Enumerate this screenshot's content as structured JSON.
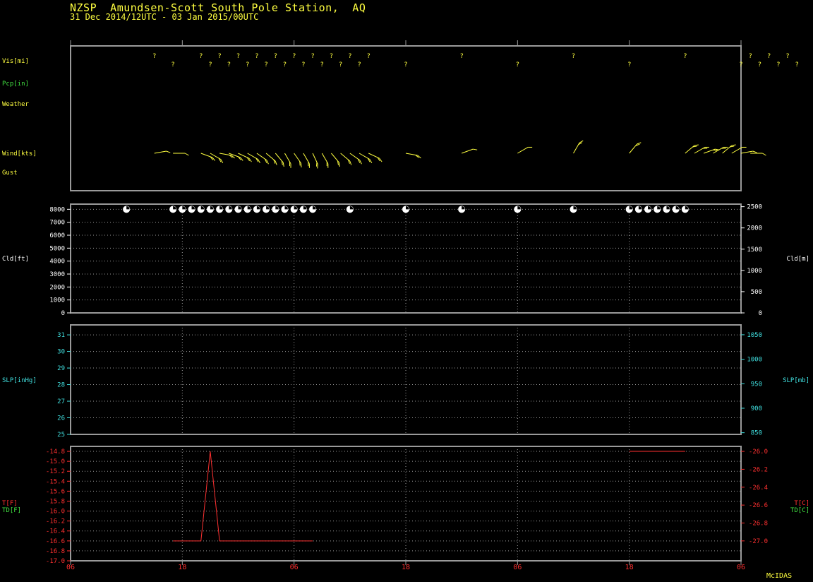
{
  "header": {
    "station_line": "NZSP  Amundsen-Scott South Pole Station,  AQ",
    "period_line": "31 Dec 2014/12UTC - 03 Jan 2015/00UTC"
  },
  "credit": "McIDAS",
  "colors": {
    "yellow": "#ffff40",
    "green": "#40e040",
    "cyan": "#40e0e0",
    "red": "#ff3030",
    "white": "#ffffff",
    "frame": "#9a9a9a",
    "grid": "#9a9a9a"
  },
  "time_axis": {
    "tick_labels": [
      "06",
      "18",
      "06",
      "18",
      "06",
      "18",
      "06"
    ],
    "grid_labels": [
      "18",
      "06",
      "18",
      "06",
      "18"
    ]
  },
  "chart_data": [
    {
      "type": "scatter",
      "panel": "surface",
      "row_labels": {
        "vis": "Vis[mi]",
        "pcp": "Pcp[in]",
        "weather": "Weather",
        "wind": "Wind[kts]",
        "gust": "Gust"
      },
      "vis_symbol": "?",
      "vis_hours": [
        9,
        11,
        14,
        15,
        16,
        17,
        18,
        19,
        20,
        21,
        22,
        23,
        24,
        25,
        26,
        27,
        28,
        29,
        30,
        31,
        32,
        36,
        42,
        48,
        54,
        60,
        66,
        72,
        73,
        74,
        75,
        76,
        77,
        78
      ],
      "wind_barbs": [
        {
          "hour": 9,
          "dir": 80,
          "spd": 10
        },
        {
          "hour": 11,
          "dir": 90,
          "spd": 10
        },
        {
          "hour": 14,
          "dir": 110,
          "spd": 15
        },
        {
          "hour": 15,
          "dir": 120,
          "spd": 15
        },
        {
          "hour": 16,
          "dir": 100,
          "spd": 15
        },
        {
          "hour": 17,
          "dir": 110,
          "spd": 15
        },
        {
          "hour": 18,
          "dir": 115,
          "spd": 15
        },
        {
          "hour": 19,
          "dir": 120,
          "spd": 15
        },
        {
          "hour": 20,
          "dir": 125,
          "spd": 15
        },
        {
          "hour": 21,
          "dir": 130,
          "spd": 15
        },
        {
          "hour": 22,
          "dir": 140,
          "spd": 15
        },
        {
          "hour": 23,
          "dir": 150,
          "spd": 15
        },
        {
          "hour": 24,
          "dir": 145,
          "spd": 15
        },
        {
          "hour": 25,
          "dir": 150,
          "spd": 15
        },
        {
          "hour": 26,
          "dir": 155,
          "spd": 15
        },
        {
          "hour": 27,
          "dir": 150,
          "spd": 15
        },
        {
          "hour": 28,
          "dir": 140,
          "spd": 15
        },
        {
          "hour": 29,
          "dir": 130,
          "spd": 15
        },
        {
          "hour": 30,
          "dir": 125,
          "spd": 15
        },
        {
          "hour": 31,
          "dir": 120,
          "spd": 15
        },
        {
          "hour": 32,
          "dir": 115,
          "spd": 15
        },
        {
          "hour": 36,
          "dir": 100,
          "spd": 15
        },
        {
          "hour": 42,
          "dir": 70,
          "spd": 10
        },
        {
          "hour": 48,
          "dir": 60,
          "spd": 10
        },
        {
          "hour": 54,
          "dir": 30,
          "spd": 15
        },
        {
          "hour": 60,
          "dir": 40,
          "spd": 15
        },
        {
          "hour": 66,
          "dir": 50,
          "spd": 15
        },
        {
          "hour": 67,
          "dir": 60,
          "spd": 15
        },
        {
          "hour": 68,
          "dir": 70,
          "spd": 15
        },
        {
          "hour": 69,
          "dir": 60,
          "spd": 15
        },
        {
          "hour": 70,
          "dir": 50,
          "spd": 15
        },
        {
          "hour": 71,
          "dir": 60,
          "spd": 10
        },
        {
          "hour": 72,
          "dir": 80,
          "spd": 10
        },
        {
          "hour": 73,
          "dir": 90,
          "spd": 10
        }
      ]
    },
    {
      "type": "scatter",
      "panel": "cloud",
      "ylabel_left": "Cld[ft]",
      "ylabel_right": "Cld[m]",
      "ylim_ft": [
        0,
        8400
      ],
      "yticks_ft": [
        "0",
        "1000",
        "2000",
        "3000",
        "4000",
        "5000",
        "6000",
        "7000",
        "8000"
      ],
      "ylim_m": [
        0,
        2560
      ],
      "yticks_m": [
        "0",
        "500",
        "1000",
        "1500",
        "2000",
        "2500"
      ],
      "cloud_symbol_hours": [
        6,
        11,
        12,
        13,
        14,
        15,
        16,
        17,
        18,
        19,
        20,
        21,
        22,
        23,
        24,
        25,
        26,
        30,
        36,
        42,
        48,
        54,
        60,
        61,
        62,
        63,
        64,
        65,
        66
      ],
      "cloud_ft": 8000
    },
    {
      "type": "line",
      "panel": "pressure",
      "ylabel_left": "SLP[inHg]",
      "ylabel_right": "SLP[mb]",
      "ylim_inhg": [
        25,
        31.6
      ],
      "yticks_inhg": [
        "25",
        "26",
        "27",
        "28",
        "29",
        "30",
        "31"
      ],
      "ylim_mb": [
        846.6,
        1070.1
      ],
      "yticks_mb": [
        "850",
        "900",
        "950",
        "1000",
        "1050"
      ],
      "series": []
    },
    {
      "type": "line",
      "panel": "temperature",
      "ylabel_left_t": "T[F]",
      "ylabel_left_td": "TD[F]",
      "ylabel_right_t": "T[C]",
      "ylabel_right_td": "TD[C]",
      "ylim_f": [
        -17.0,
        -14.7
      ],
      "yticks_f": [
        "-17.0",
        "-16.8",
        "-16.6",
        "-16.4",
        "-16.2",
        "-16.0",
        "-15.8",
        "-15.6",
        "-15.4",
        "-15.2",
        "-15.0",
        "-14.8"
      ],
      "yticks_c": [
        "-27.0",
        "-26.8",
        "-26.6",
        "-26.4",
        "-26.2",
        "-26.0"
      ],
      "xlim_hours": [
        0,
        72
      ],
      "series": [
        {
          "x": [
            11,
            14,
            15,
            16,
            26
          ],
          "y": [
            -16.6,
            -16.6,
            -14.8,
            -16.6,
            -16.6
          ]
        },
        {
          "x": [
            60,
            66
          ],
          "y": [
            -14.8,
            -14.8
          ]
        }
      ]
    }
  ]
}
